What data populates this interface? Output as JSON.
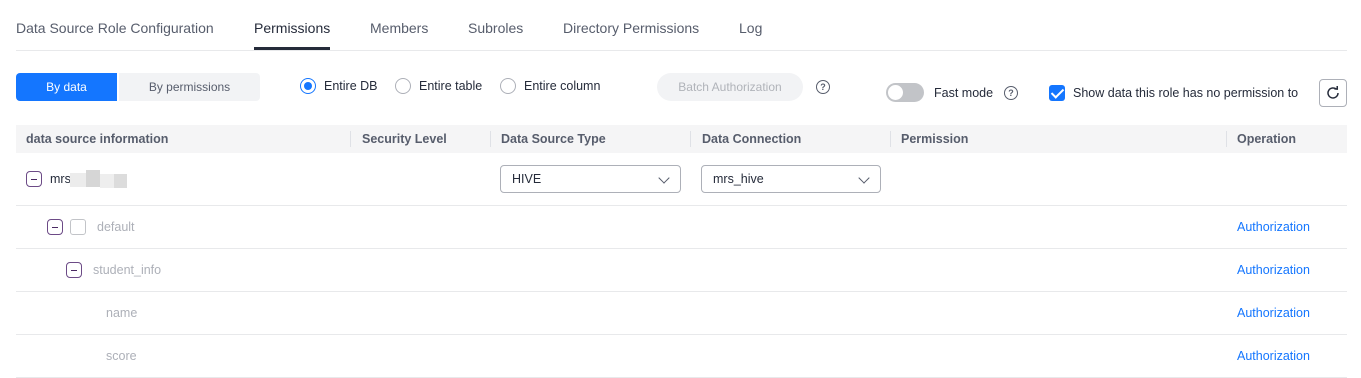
{
  "tabs": [
    {
      "label": "Data Source Role Configuration",
      "active": false
    },
    {
      "label": "Permissions",
      "active": true
    },
    {
      "label": "Members",
      "active": false
    },
    {
      "label": "Subroles",
      "active": false
    },
    {
      "label": "Directory Permissions",
      "active": false
    },
    {
      "label": "Log",
      "active": false
    }
  ],
  "toolbar": {
    "view_toggle": {
      "by_data": "By data",
      "by_permissions": "By permissions",
      "selected": "By data"
    },
    "scope": {
      "entire_db": "Entire DB",
      "entire_table": "Entire table",
      "entire_column": "Entire column",
      "selected": "Entire DB"
    },
    "batch_authorization": "Batch Authorization",
    "fast_mode": {
      "label": "Fast mode",
      "enabled": false
    },
    "show_no_permission": {
      "label": "Show data this role has no permission to",
      "checked": true
    }
  },
  "table": {
    "columns": [
      "data source information",
      "Security Level",
      "Data Source Type",
      "Data Connection",
      "Permission",
      "Operation"
    ],
    "rows": [
      {
        "name": "mrs",
        "data_source_type": "HIVE",
        "data_connection": "mrs_hive"
      },
      {
        "name": "default",
        "operation": "Authorization"
      },
      {
        "name": "student_info",
        "operation": "Authorization"
      },
      {
        "name": "name",
        "operation": "Authorization"
      },
      {
        "name": "score",
        "operation": "Authorization"
      }
    ]
  },
  "colors": {
    "accent": "#1476ff",
    "text": "#252b3a",
    "muted": "#adb0b8"
  }
}
